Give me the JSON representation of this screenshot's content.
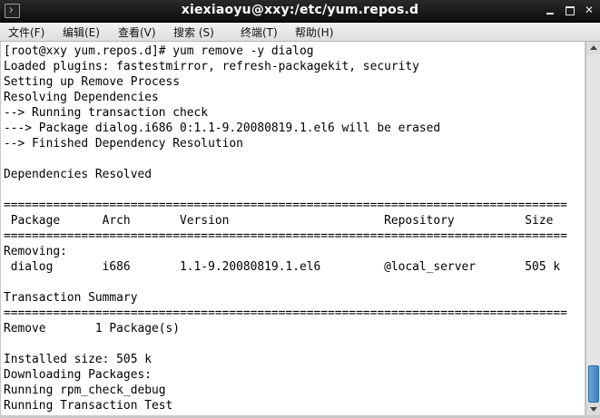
{
  "window": {
    "title": "xiexiaoyu@xxy:/etc/yum.repos.d",
    "controls": {
      "minimize_icon": "minimize-icon",
      "maximize_icon": "maximize-icon",
      "close_label": "✕"
    }
  },
  "menu": [
    {
      "label": "文件(F)"
    },
    {
      "label": "编辑(E)"
    },
    {
      "label": "查看(V)"
    },
    {
      "label": "搜索 (S)"
    },
    {
      "label": "终端(T)"
    },
    {
      "label": "帮助(H)"
    }
  ],
  "terminal": {
    "lines": [
      "[root@xxy yum.repos.d]# yum remove -y dialog",
      "Loaded plugins: fastestmirror, refresh-packagekit, security",
      "Setting up Remove Process",
      "Resolving Dependencies",
      "--> Running transaction check",
      "---> Package dialog.i686 0:1.1-9.20080819.1.el6 will be erased",
      "--> Finished Dependency Resolution",
      "",
      "Dependencies Resolved",
      "",
      "================================================================================",
      " Package      Arch       Version                      Repository          Size",
      "================================================================================",
      "Removing:",
      " dialog       i686       1.1-9.20080819.1.el6         @local_server       505 k",
      "",
      "Transaction Summary",
      "================================================================================",
      "Remove       1 Package(s)",
      "",
      "Installed size: 505 k",
      "Downloading Packages:",
      "Running rpm_check_debug",
      "Running Transaction Test"
    ]
  },
  "colors": {
    "titlebar": "#111111",
    "terminal_bg": "#ffffff",
    "terminal_fg": "#000000",
    "scroll_thumb": "#4f8fcf"
  }
}
